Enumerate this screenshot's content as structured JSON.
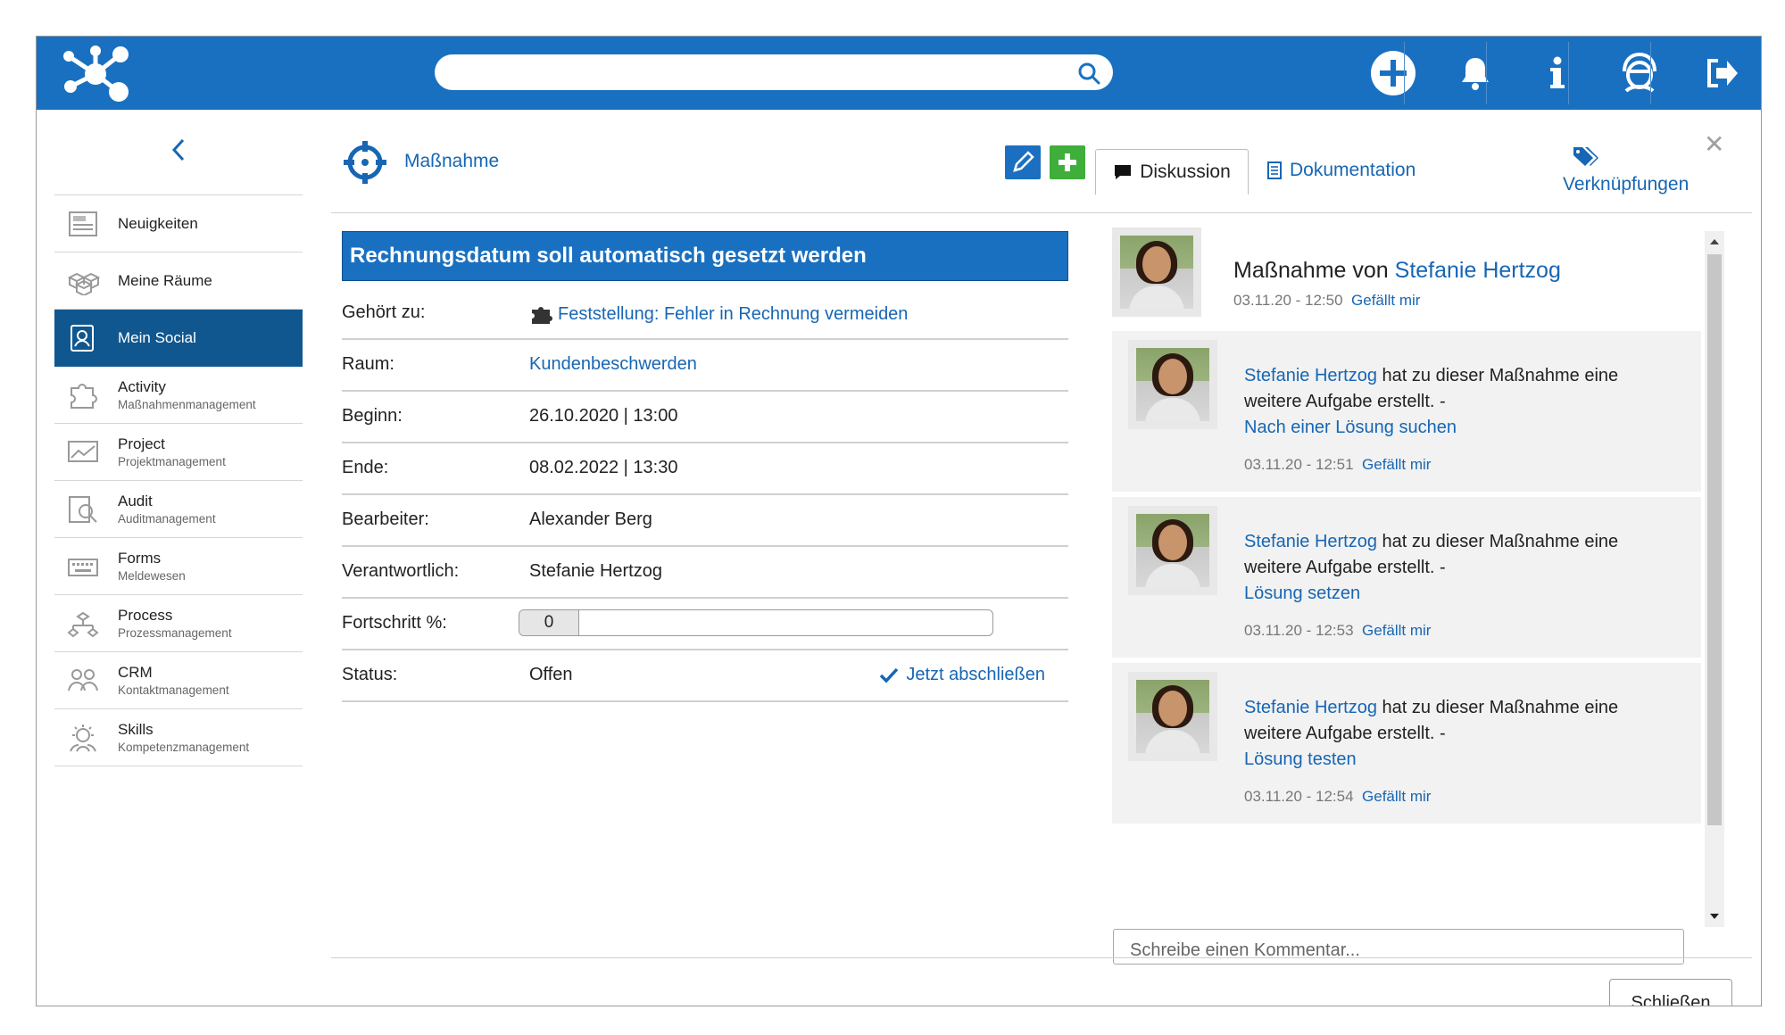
{
  "header": {
    "search_placeholder": "",
    "icons": [
      "logo-network-icon",
      "search-icon",
      "plus-circle-icon",
      "bell-icon",
      "info-icon",
      "user-avatar-icon",
      "logout-icon"
    ]
  },
  "sidebar": {
    "items": [
      {
        "label": "Neuigkeiten",
        "sub": "",
        "icon": "news-icon",
        "active": false
      },
      {
        "label": "Meine Räume",
        "sub": "",
        "icon": "cubes-icon",
        "active": false
      },
      {
        "label": "Mein Social",
        "sub": "",
        "icon": "social-icon",
        "active": true
      },
      {
        "label": "Activity",
        "sub": "Maßnahmenmanagement",
        "icon": "puzzle-icon",
        "active": false
      },
      {
        "label": "Project",
        "sub": "Projektmanagement",
        "icon": "chart-icon",
        "active": false
      },
      {
        "label": "Audit",
        "sub": "Auditmanagement",
        "icon": "audit-icon",
        "active": false
      },
      {
        "label": "Forms",
        "sub": "Meldewesen",
        "icon": "keyboard-icon",
        "active": false
      },
      {
        "label": "Process",
        "sub": "Prozessmanagement",
        "icon": "process-icon",
        "active": false
      },
      {
        "label": "CRM",
        "sub": "Kontaktmanagement",
        "icon": "crm-icon",
        "active": false
      },
      {
        "label": "Skills",
        "sub": "Kompetenzmanagement",
        "icon": "skills-icon",
        "active": false
      }
    ]
  },
  "detail": {
    "type_label": "Maßnahme",
    "tab_discussion": "Diskussion",
    "tab_documentation": "Dokumentation",
    "links_label": "Verknüpfungen",
    "title": "Rechnungsdatum soll automatisch gesetzt werden",
    "fields": {
      "belongs_label": "Gehört zu:",
      "belongs_value": "Feststellung: Fehler in Rechnung vermeiden",
      "room_label": "Raum:",
      "room_value": "Kundenbeschwerden",
      "start_label": "Beginn:",
      "start_value": "26.10.2020 | 13:00",
      "end_label": "Ende:",
      "end_value": "08.02.2022 | 13:30",
      "editor_label": "Bearbeiter:",
      "editor_value": "Alexander Berg",
      "responsible_label": "Verantwortlich:",
      "responsible_value": "Stefanie Hertzog",
      "progress_label": "Fortschritt %:",
      "progress_value": "0",
      "status_label": "Status:",
      "status_value": "Offen",
      "complete_label": "Jetzt abschließen"
    },
    "close_label": "Schließen"
  },
  "discussion": {
    "head": {
      "prefix": "Maßnahme von ",
      "author": "Stefanie Hertzog",
      "time": "03.11.20 - 12:50",
      "like": "Gefällt mir"
    },
    "entries": [
      {
        "author": "Stefanie Hertzog",
        "text": " hat zu dieser Maßnahme eine weitere Aufgabe erstellt. -",
        "task": "Nach einer Lösung suchen",
        "time": "03.11.20 - 12:51",
        "like": "Gefällt mir"
      },
      {
        "author": "Stefanie Hertzog",
        "text": " hat zu dieser Maßnahme eine weitere Aufgabe erstellt. -",
        "task": "Lösung setzen",
        "time": "03.11.20 - 12:53",
        "like": "Gefällt mir"
      },
      {
        "author": "Stefanie Hertzog",
        "text": " hat zu dieser Maßnahme eine weitere Aufgabe erstellt. -",
        "task": "Lösung testen",
        "time": "03.11.20 - 12:54",
        "like": "Gefällt mir"
      }
    ],
    "comment_placeholder": "Schreibe einen Kommentar..."
  },
  "colors": {
    "brand": "#1a70c0",
    "active_nav": "#11578f",
    "link": "#1766b4",
    "add_green": "#3fae3a"
  }
}
